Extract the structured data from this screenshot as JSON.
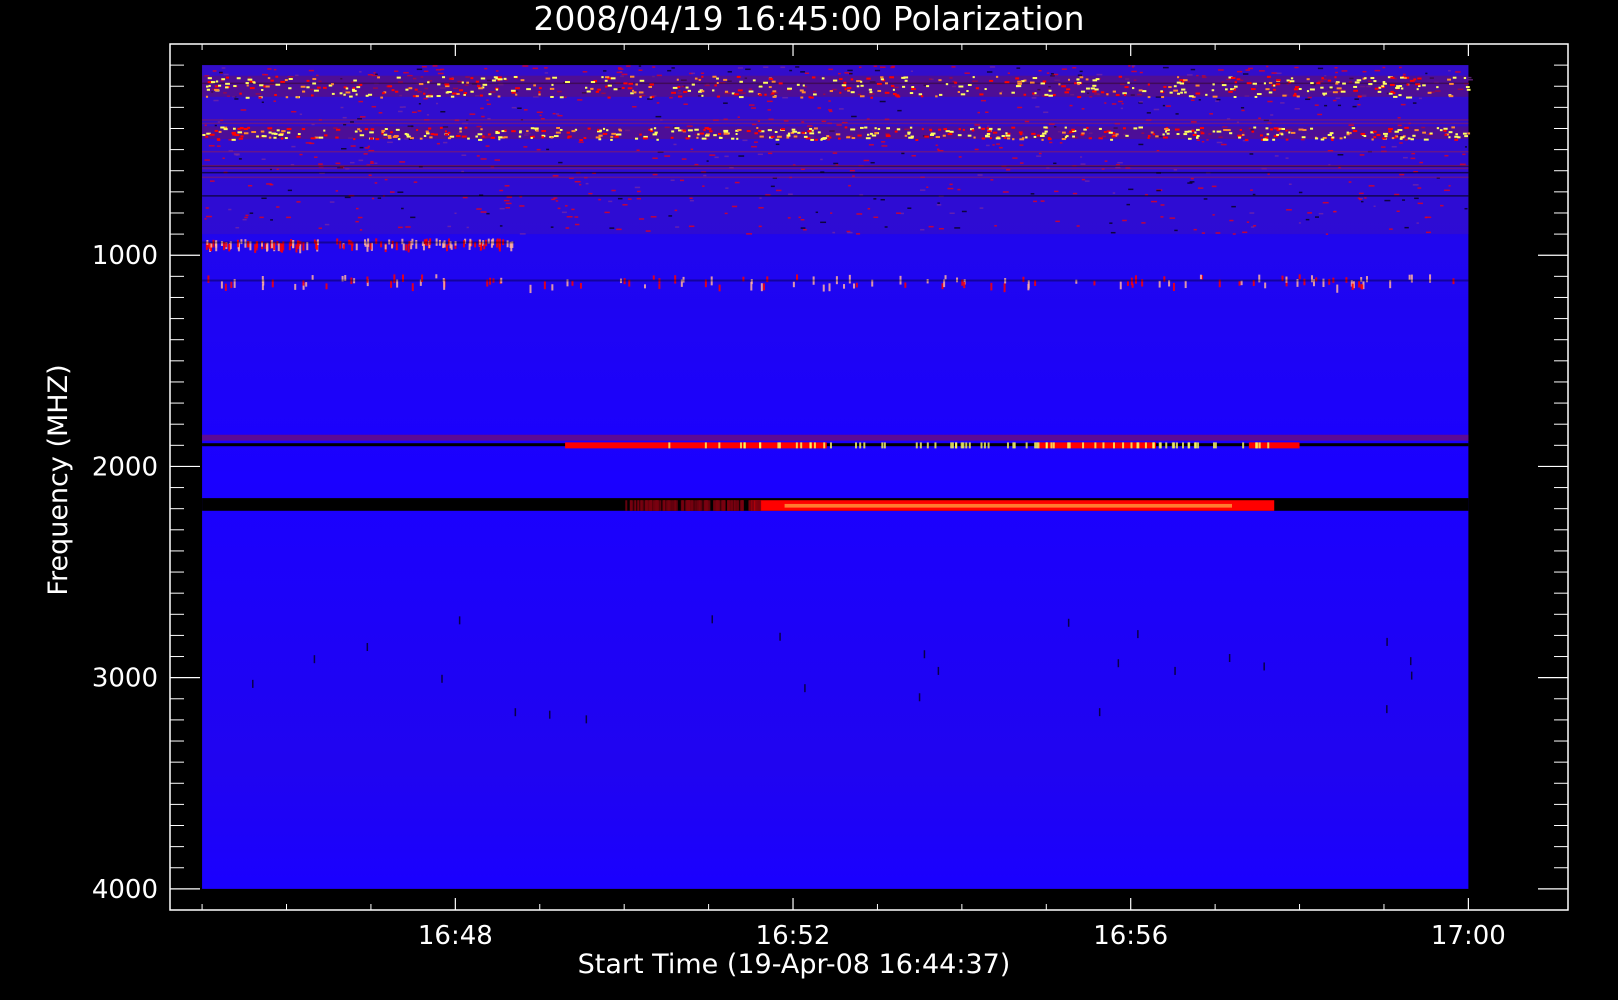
{
  "chart_data": {
    "type": "heatmap",
    "title": "2008/04/19 16:45:00 Polarization",
    "xlabel": "Start Time (19-Apr-08 16:44:37)",
    "ylabel": "Frequency (MHZ)",
    "x_tick_labels": [
      "16:48",
      "16:52",
      "16:56",
      "17:00"
    ],
    "x_tick_minutes": [
      48,
      52,
      56,
      60
    ],
    "x_range_minutes": [
      44.62,
      61.18
    ],
    "data_x_range_minutes": [
      45.0,
      60.0
    ],
    "y_tick_labels": [
      "1000",
      "2000",
      "3000",
      "4000"
    ],
    "y_ticks": [
      1000,
      2000,
      3000,
      4000
    ],
    "y_range": [
      0,
      4100
    ],
    "data_y_range": [
      100,
      4000
    ],
    "y_inverted": true,
    "colormap": [
      "#000000",
      "#1c00ff",
      "#ff0000",
      "#ffff60"
    ],
    "background_color": "#1a00ff",
    "features": [
      {
        "start_min": 45.0,
        "end_min": 60.0,
        "freq_low": 100,
        "freq_high": 900,
        "kind": "noisy"
      },
      {
        "start_min": 45.0,
        "end_min": 60.0,
        "freq_low": 150,
        "freq_high": 250,
        "kind": "rfi_yellow"
      },
      {
        "start_min": 45.0,
        "end_min": 60.0,
        "freq_low": 390,
        "freq_high": 450,
        "kind": "rfi_yellow"
      },
      {
        "start_min": 45.0,
        "end_min": 48.7,
        "freq_low": 920,
        "freq_high": 950,
        "kind": "dotted"
      },
      {
        "start_min": 45.0,
        "end_min": 60.0,
        "freq_low": 1090,
        "freq_high": 1140,
        "kind": "dotted"
      },
      {
        "start_min": 45.0,
        "end_min": 60.0,
        "freq_low": 1850,
        "freq_high": 1930,
        "kind": "band"
      },
      {
        "start_min": 45.0,
        "end_min": 60.0,
        "freq_low": 2150,
        "freq_high": 2210,
        "kind": "dark_band"
      },
      {
        "start_min": 51.5,
        "end_min": 57.7,
        "freq_low": 2160,
        "freq_high": 2210,
        "kind": "red_burst"
      }
    ]
  }
}
